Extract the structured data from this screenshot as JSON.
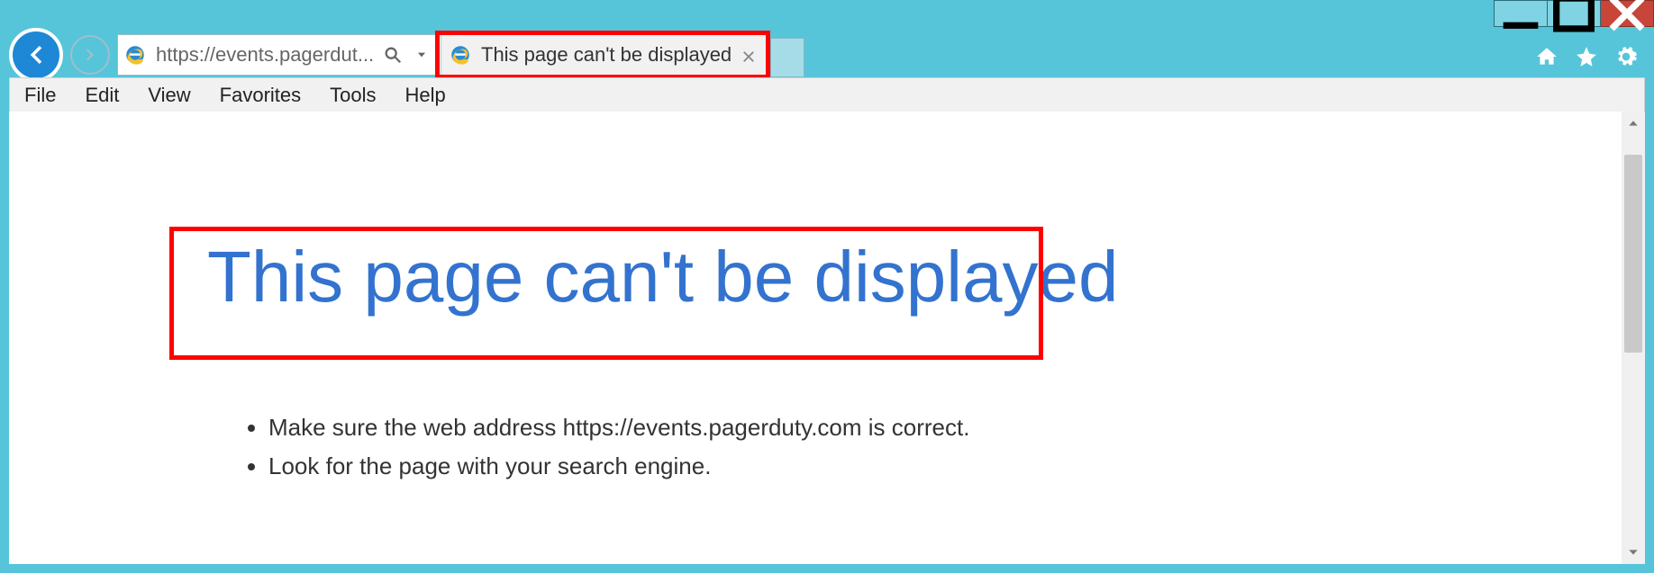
{
  "window_controls": {
    "minimize_label": "–",
    "maximize_label": "◻",
    "close_label": "x"
  },
  "chrome_icons": {
    "home": "home-icon",
    "favorites": "star-icon",
    "settings": "gear-icon"
  },
  "navigation": {
    "back": "back-icon",
    "forward": "forward-icon",
    "address_text": "https://events.pagerdut...",
    "search": "search-icon",
    "dropdown": "chevron-down-icon",
    "refresh": "refresh-icon",
    "ie_logo": "ie-icon"
  },
  "tab": {
    "title": "This page can't be displayed",
    "close": "close-icon"
  },
  "menubar": {
    "file": "File",
    "edit": "Edit",
    "view": "View",
    "favorites": "Favorites",
    "tools": "Tools",
    "help": "Help"
  },
  "page": {
    "heading": "This page can't be displayed",
    "tips": [
      "Make sure the web address https://events.pagerduty.com is correct.",
      "Look for the page with your search engine."
    ]
  },
  "annotations": {
    "highlight_color": "#ff0000"
  }
}
